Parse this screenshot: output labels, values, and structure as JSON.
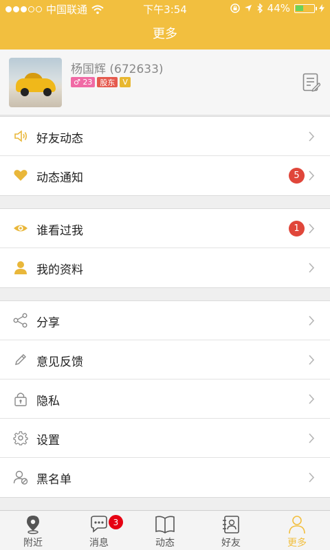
{
  "status_bar": {
    "carrier": "中国联通",
    "time": "下午3:54",
    "battery_percent": "44%",
    "battery_level": 0.44
  },
  "nav": {
    "title": "更多"
  },
  "profile": {
    "name": "杨国辉 (672633)",
    "gender_age": "♂ 23",
    "role_tag": "股东",
    "vip_tag": "V"
  },
  "groups": [
    {
      "items": [
        {
          "label": "好友动态",
          "icon": "speaker-icon"
        },
        {
          "label": "动态通知",
          "icon": "heart-icon",
          "badge": "5"
        }
      ]
    },
    {
      "items": [
        {
          "label": "谁看过我",
          "icon": "eye-icon",
          "badge": "1"
        },
        {
          "label": "我的资料",
          "icon": "person-icon"
        }
      ]
    },
    {
      "items": [
        {
          "label": "分享",
          "icon": "share-icon"
        },
        {
          "label": "意见反馈",
          "icon": "pencil-icon"
        },
        {
          "label": "隐私",
          "icon": "lock-icon"
        },
        {
          "label": "设置",
          "icon": "gear-icon"
        },
        {
          "label": "黑名单",
          "icon": "blocked-user-icon"
        }
      ]
    }
  ],
  "tabbar": {
    "tabs": [
      {
        "label": "附近",
        "icon": "location-pin-icon"
      },
      {
        "label": "消息",
        "icon": "chat-bubble-icon",
        "badge": "3"
      },
      {
        "label": "动态",
        "icon": "book-icon"
      },
      {
        "label": "好友",
        "icon": "contacts-icon"
      },
      {
        "label": "更多",
        "icon": "person-outline-icon",
        "active": true
      }
    ]
  },
  "colors": {
    "accent": "#f2bf3f",
    "badge_red": "#e0463a",
    "icon_yellow": "#e9b73a"
  }
}
